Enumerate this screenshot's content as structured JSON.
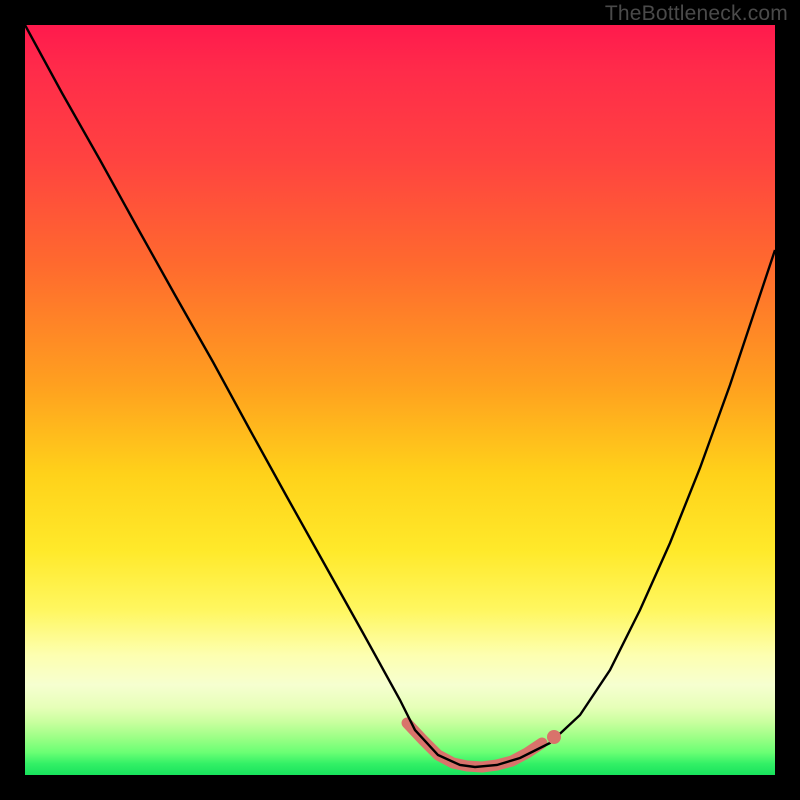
{
  "watermark": {
    "text": "TheBottleneck.com"
  },
  "chart_data": {
    "type": "line",
    "title": "",
    "xlabel": "",
    "ylabel": "",
    "xlim": [
      0,
      100
    ],
    "ylim": [
      0,
      100
    ],
    "grid": false,
    "legend": false,
    "background_gradient": {
      "orientation": "vertical",
      "stops": [
        {
          "pos": 0,
          "color": "#ff1a4d"
        },
        {
          "pos": 50,
          "color": "#ffa01f"
        },
        {
          "pos": 70,
          "color": "#ffe92a"
        },
        {
          "pos": 88,
          "color": "#f6ffd0"
        },
        {
          "pos": 100,
          "color": "#17e25c"
        }
      ]
    },
    "series": [
      {
        "name": "bottleneck-curve",
        "stroke": "#000000",
        "x": [
          0,
          5,
          10,
          15,
          20,
          25,
          30,
          35,
          40,
          45,
          50,
          52,
          55,
          58,
          60,
          63,
          66,
          70,
          74,
          78,
          82,
          86,
          90,
          94,
          100
        ],
        "values": [
          100,
          91,
          82,
          73,
          64,
          55,
          46,
          37,
          28,
          19,
          10,
          6,
          2,
          1,
          1,
          1,
          2,
          4,
          8,
          14,
          22,
          31,
          41,
          52,
          70
        ]
      },
      {
        "name": "highlight-band",
        "stroke": "#d9736b",
        "stroke_width_px": 10,
        "x": [
          51,
          53,
          55,
          57,
          59,
          61,
          63,
          65,
          67,
          69
        ],
        "values": [
          7,
          4,
          2,
          1,
          1,
          1,
          1,
          2,
          3,
          4
        ]
      }
    ],
    "markers": [
      {
        "name": "highlight-dot",
        "x": 70.5,
        "y": 5,
        "color": "#d9736b",
        "radius_px": 7
      }
    ]
  }
}
